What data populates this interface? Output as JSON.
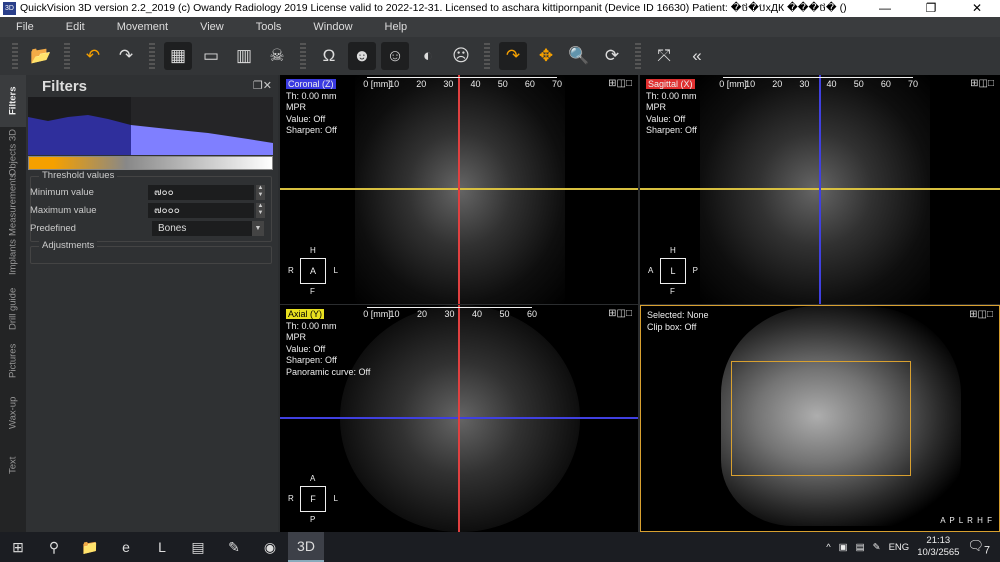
{
  "window": {
    "title": "QuickVision 3D version 2.2_2019 (c) Owandy Radiology 2019 License valid to 2022-12-31. Licensed to aschara kittipornpanit (Device ID 16630) Patient: �ថ�បxДК ���ថ�  ()",
    "app_icon": "3D",
    "controls": [
      "—",
      "❐",
      "✕"
    ]
  },
  "menu": [
    "File",
    "Edit",
    "Movement",
    "View",
    "Tools",
    "Window",
    "Help"
  ],
  "toolbar": [
    {
      "name": "open-patient",
      "glyph": "📂",
      "active": false
    },
    {
      "name": "undo",
      "glyph": "↶",
      "active": false
    },
    {
      "name": "redo",
      "glyph": "↷",
      "active": false
    },
    {
      "name": "layout-mpr",
      "glyph": "▦",
      "active": true
    },
    {
      "name": "panoramic",
      "glyph": "▭",
      "active": false
    },
    {
      "name": "layout-3d",
      "glyph": "▥",
      "active": false
    },
    {
      "name": "skull-view",
      "glyph": "☠",
      "active": false
    },
    {
      "name": "nerve-canal",
      "glyph": "Ω",
      "active": false
    },
    {
      "name": "bone-render",
      "glyph": "☻",
      "active": true
    },
    {
      "name": "skin-render",
      "glyph": "☺",
      "active": true
    },
    {
      "name": "sphere",
      "glyph": "◐",
      "active": false
    },
    {
      "name": "transparent-skull",
      "glyph": "☹",
      "active": false
    },
    {
      "name": "rotate",
      "glyph": "↷",
      "active": true
    },
    {
      "name": "pan",
      "glyph": "✥",
      "active": false
    },
    {
      "name": "zoom",
      "glyph": "🔍",
      "active": false
    },
    {
      "name": "reset",
      "glyph": "⟳",
      "active": false
    },
    {
      "name": "axes",
      "glyph": "⤧",
      "active": false
    },
    {
      "name": "export",
      "glyph": "«",
      "active": false
    }
  ],
  "side_tabs": [
    "Filters",
    "Objects 3D",
    "Measurements",
    "Implants",
    "Drill guide",
    "Pictures",
    "Wax-up",
    "Text"
  ],
  "filters": {
    "title": "Filters",
    "threshold_title": "Threshold values",
    "min_label": "Minimum value",
    "min_value": "๗๐๐",
    "max_label": "Maximum value",
    "max_value": "๗๐๐๐",
    "predefined_label": "Predefined",
    "predefined_value": "Bones",
    "adjustments_title": "Adjustments"
  },
  "viewports": {
    "coronal": {
      "label": "Coronal (Z)",
      "label_color": "#3a3ae0",
      "info": [
        "Th: 0.00 mm",
        "MPR",
        "Value: Off",
        "Sharpen: Off"
      ],
      "ruler": [
        "0 [mm]",
        "10",
        "20",
        "30",
        "40",
        "50",
        "60",
        "70"
      ],
      "orient": {
        "top": "H",
        "bottom": "F",
        "left": "R",
        "right": "L",
        "center": "A"
      }
    },
    "sagittal": {
      "label": "Sagittal (X)",
      "label_color": "#e03030",
      "info": [
        "Th: 0.00 mm",
        "MPR",
        "Value: Off",
        "Sharpen: Off"
      ],
      "ruler": [
        "0 [mm]",
        "10",
        "20",
        "30",
        "40",
        "50",
        "60",
        "70"
      ],
      "orient": {
        "top": "H",
        "bottom": "F",
        "left": "A",
        "right": "P",
        "center": "L"
      }
    },
    "axial": {
      "label": "Axial (Y)",
      "label_color": "#e8e020",
      "info": [
        "Th: 0.00 mm",
        "MPR",
        "Value: Off",
        "Sharpen: Off",
        "Panoramic curve: Off"
      ],
      "ruler": [
        "0 [mm]",
        "10",
        "20",
        "30",
        "40",
        "50",
        "60"
      ],
      "orient": {
        "top": "A",
        "bottom": "P",
        "left": "R",
        "right": "L",
        "center": "F"
      }
    },
    "volume": {
      "info": [
        "Selected: None",
        "Clip box: Off"
      ],
      "orient_letters": "A P L R H F"
    }
  },
  "view_buttons": "⊞◫□",
  "taskbar": {
    "items": [
      "⊞",
      "⚲",
      "📁",
      "e",
      "L",
      "▤",
      "✎",
      "◉",
      "3D"
    ],
    "tray": {
      "chevron": "^",
      "lang": "ENG",
      "time": "21:13",
      "date": "10/3/2565",
      "notif": "7"
    }
  }
}
